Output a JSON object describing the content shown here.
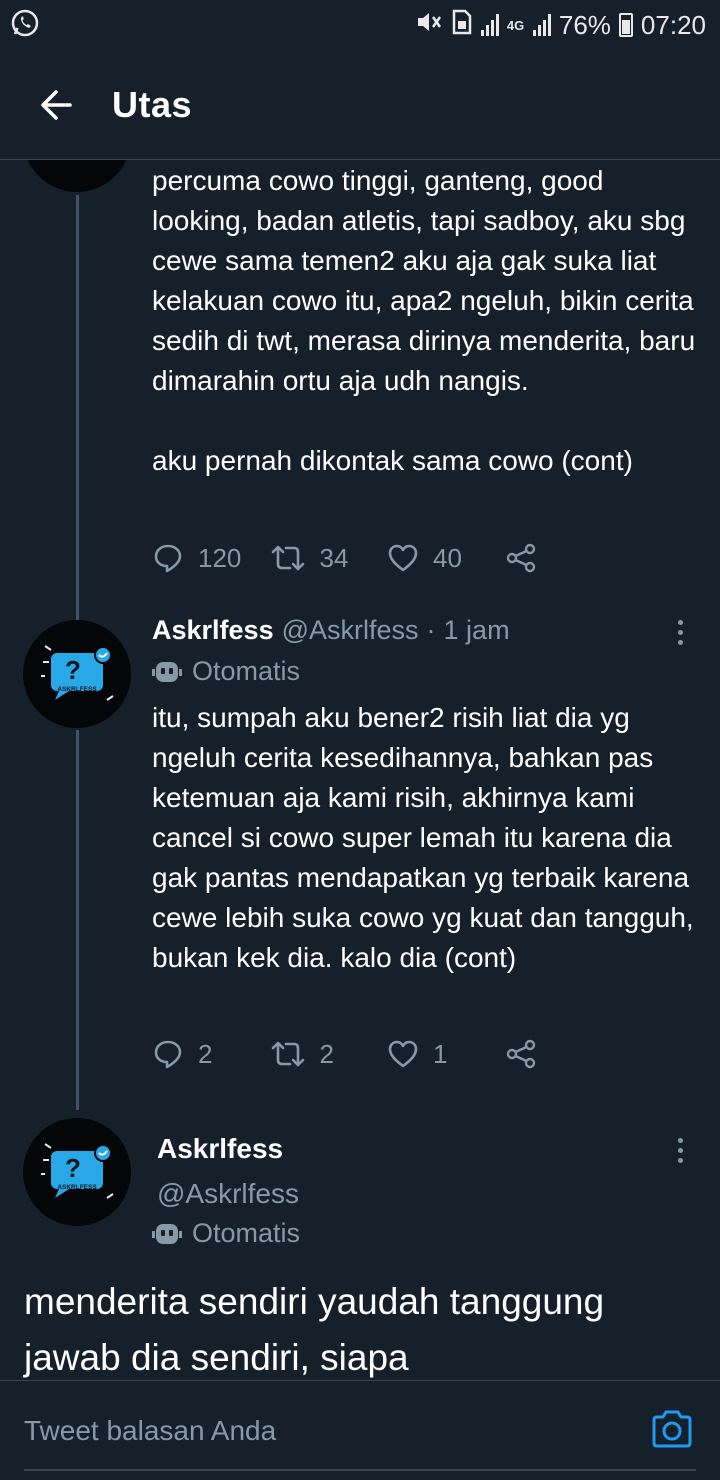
{
  "status_bar": {
    "battery": "76%",
    "time": "07:20",
    "network": "4G"
  },
  "header": {
    "title": "Utas"
  },
  "tweets": [
    {
      "text": "percuma cowo tinggi, ganteng, good looking, badan atletis, tapi sadboy, aku sbg cewe sama temen2 aku aja gak suka liat kelakuan cowo itu, apa2 ngeluh, bikin cerita sedih di twt, merasa dirinya menderita, baru dimarahin ortu aja udh nangis.\n\naku pernah dikontak sama cowo (cont)",
      "replies": "120",
      "retweets": "34",
      "likes": "40"
    },
    {
      "name": "Askrlfess",
      "handle": "@Askrlfess",
      "separator": "·",
      "time": "1 jam",
      "label": "Otomatis",
      "text": "itu, sumpah aku bener2 risih liat dia yg ngeluh cerita kesedihannya, bahkan pas ketemuan aja kami risih, akhirnya kami cancel si cowo super lemah itu karena dia gak pantas mendapatkan yg terbaik karena cewe lebih suka cowo yg kuat dan tangguh, bukan kek dia. kalo dia (cont)",
      "replies": "2",
      "retweets": "2",
      "likes": "1"
    }
  ],
  "main_tweet": {
    "name": "Askrlfess",
    "handle": "@Askrlfess",
    "label": "Otomatis",
    "text": "menderita sendiri yaudah tanggung jawab dia sendiri, siapa"
  },
  "avatar_text": "ASKRLFESS",
  "reply": {
    "placeholder": "Tweet balasan Anda"
  },
  "colors": {
    "background": "#15202b",
    "secondary_text": "#8899a6",
    "accent": "#1d9bf0"
  }
}
